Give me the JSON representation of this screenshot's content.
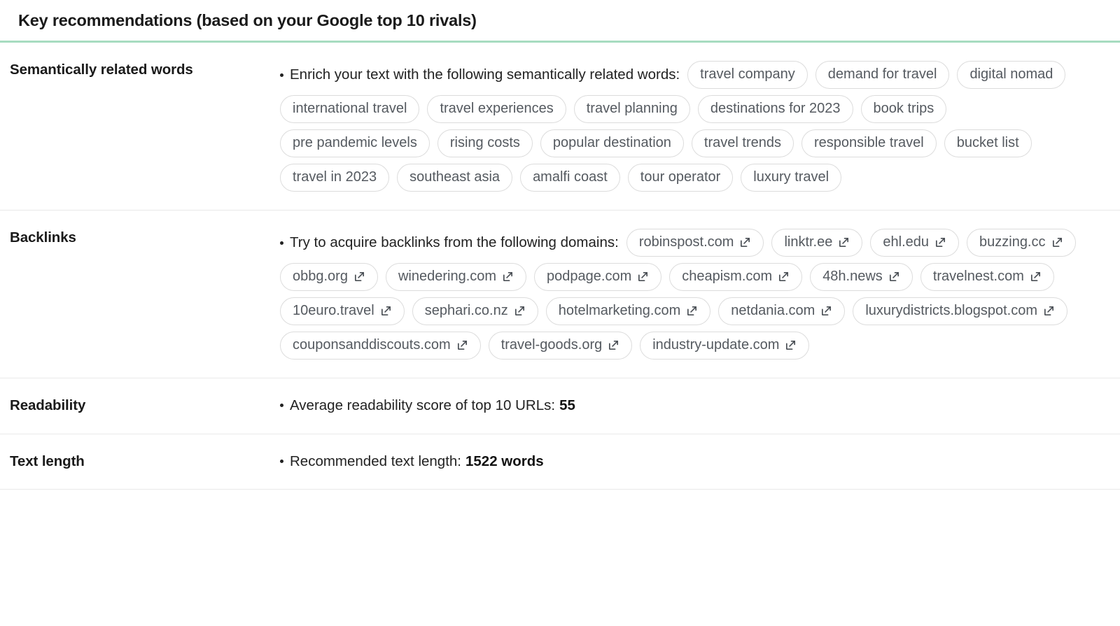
{
  "header": {
    "title": "Key recommendations (based on your Google top 10 rivals)",
    "accent_color": "#a7dcc0"
  },
  "sections": {
    "semantic": {
      "label": "Semantically related words",
      "bullet": "Enrich your text with the following semantically related words:",
      "tags": [
        "travel company",
        "demand for travel",
        "digital nomad",
        "international travel",
        "travel experiences",
        "travel planning",
        "destinations for 2023",
        "book trips",
        "pre pandemic levels",
        "rising costs",
        "popular destination",
        "travel trends",
        "responsible travel",
        "bucket list",
        "travel in 2023",
        "southeast asia",
        "amalfi coast",
        "tour operator",
        "luxury travel"
      ]
    },
    "backlinks": {
      "label": "Backlinks",
      "bullet": "Try to acquire backlinks from the following domains:",
      "icon": "external-link-icon",
      "domains": [
        "robinspost.com",
        "linktr.ee",
        "ehl.edu",
        "buzzing.cc",
        "obbg.org",
        "winedering.com",
        "podpage.com",
        "cheapism.com",
        "48h.news",
        "travelnest.com",
        "10euro.travel",
        "sephari.co.nz",
        "hotelmarketing.com",
        "netdania.com",
        "luxurydistricts.blogspot.com",
        "couponsanddiscouts.com",
        "travel-goods.org",
        "industry-update.com"
      ]
    },
    "readability": {
      "label": "Readability",
      "bullet_prefix": "Average readability score of top 10 URLs:",
      "value": "55"
    },
    "text_length": {
      "label": "Text length",
      "bullet_prefix": "Recommended text length:",
      "value": "1522 words"
    }
  }
}
